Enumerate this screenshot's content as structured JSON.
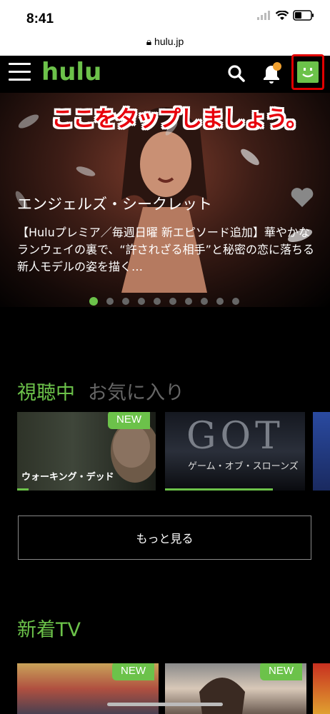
{
  "status_bar": {
    "time": "8:41",
    "url": "hulu.jp"
  },
  "nav": {
    "logo": "hulu",
    "notification_color": "#f0a030"
  },
  "hero": {
    "callout": "ここをタップしましょう。",
    "title": "エンジェルズ・シークレット",
    "description": "【Huluプレミア／毎週日曜 新エピソード追加】華やかなランウェイの裏で、“許されざる相手”と秘密の恋に落ちる新人モデルの姿を描く…",
    "dots_total": 10,
    "dots_active_index": 0
  },
  "tabs": {
    "active": "視聴中",
    "inactive": "お気に入り"
  },
  "watching": {
    "items": [
      {
        "caption": "ウォーキング・デッド",
        "badge": "NEW",
        "progress": 0.08
      },
      {
        "caption": "ゲーム・オブ・スローンズ",
        "badge": "",
        "progress": 0.77,
        "art_text": "GOT"
      }
    ],
    "more_label": "もっと見る"
  },
  "new_tv": {
    "title": "新着TV",
    "items": [
      {
        "badge": "NEW"
      },
      {
        "badge": "NEW"
      }
    ]
  },
  "colors": {
    "accent": "#6cc24a",
    "highlight": "#e00000"
  }
}
